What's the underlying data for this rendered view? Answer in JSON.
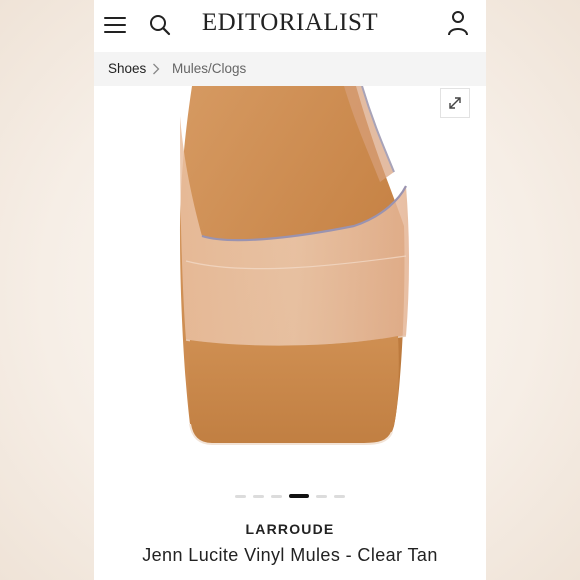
{
  "header": {
    "logo_left": "EDITORI",
    "logo_slash": "A",
    "logo_right": "LIST",
    "icons": {
      "menu": "hamburger-icon",
      "search": "search-icon",
      "account": "user-icon"
    }
  },
  "breadcrumb": {
    "items": [
      "Shoes",
      "Mules/Clogs"
    ]
  },
  "gallery": {
    "slide_count": 6,
    "active_index": 3,
    "expand_icon": "expand-icon"
  },
  "product": {
    "brand": "LARROUDE",
    "name": "Jenn Lucite Vinyl Mules - Clear Tan"
  },
  "colors": {
    "page_bg": "#f6eee6",
    "tan": "#c98a52",
    "text": "#222222"
  }
}
